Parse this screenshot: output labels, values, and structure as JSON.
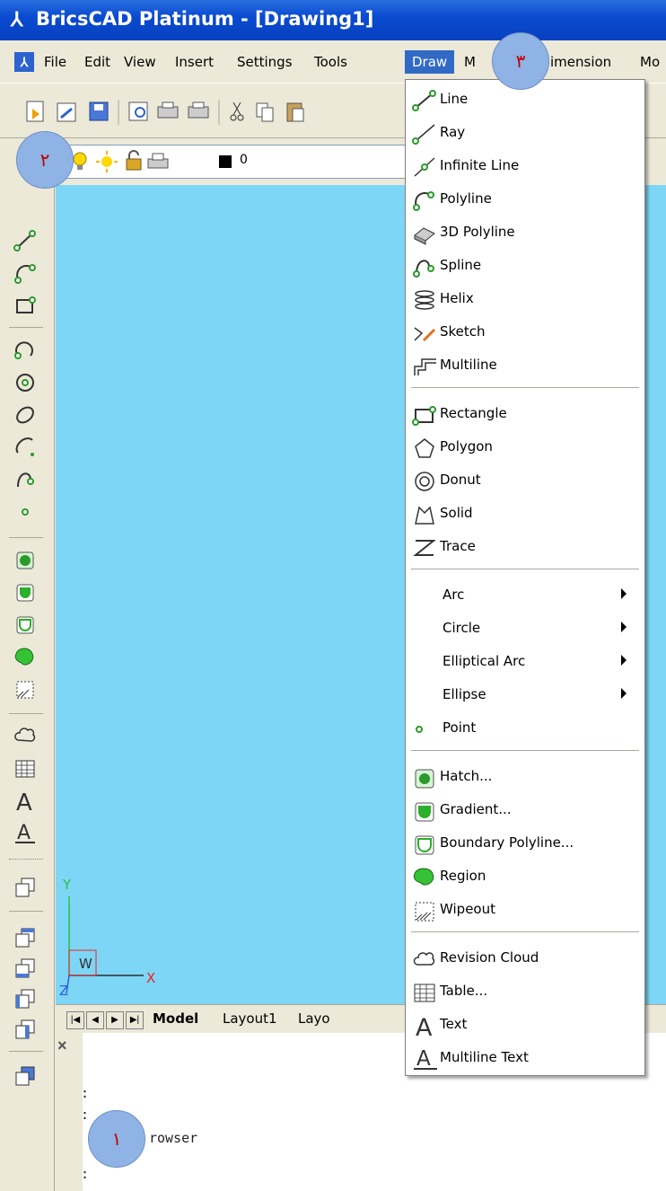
{
  "window": {
    "title": "BricsCAD Platinum - [Drawing1]"
  },
  "menubar": {
    "items": [
      "File",
      "Edit",
      "View",
      "Insert",
      "Settings",
      "Tools",
      "Draw",
      "M",
      "imension",
      "Mo"
    ],
    "active": "Draw"
  },
  "layer": {
    "name": "0"
  },
  "draw_menu": {
    "items": [
      {
        "label": "Line",
        "icon": "line-icon"
      },
      {
        "label": "Ray",
        "icon": "ray-icon"
      },
      {
        "label": "Infinite Line",
        "icon": "infinite-line-icon"
      },
      {
        "label": "Polyline",
        "icon": "polyline-icon"
      },
      {
        "label": "3D Polyline",
        "icon": "3d-polyline-icon"
      },
      {
        "label": "Spline",
        "icon": "spline-icon"
      },
      {
        "label": "Helix",
        "icon": "helix-icon"
      },
      {
        "label": "Sketch",
        "icon": "sketch-icon"
      },
      {
        "label": "Multiline",
        "icon": "multiline-icon"
      },
      {
        "label": "Rectangle",
        "icon": "rectangle-icon"
      },
      {
        "label": "Polygon",
        "icon": "polygon-icon"
      },
      {
        "label": "Donut",
        "icon": "donut-icon"
      },
      {
        "label": "Solid",
        "icon": "solid-icon"
      },
      {
        "label": "Trace",
        "icon": "trace-icon"
      },
      {
        "label": "Arc",
        "icon": ""
      },
      {
        "label": "Circle",
        "icon": ""
      },
      {
        "label": "Elliptical Arc",
        "icon": ""
      },
      {
        "label": "Ellipse",
        "icon": ""
      },
      {
        "label": "Point",
        "icon": "point-icon"
      },
      {
        "label": "Hatch...",
        "icon": "hatch-icon"
      },
      {
        "label": "Gradient...",
        "icon": "gradient-icon"
      },
      {
        "label": "Boundary Polyline...",
        "icon": "boundary-polyline-icon"
      },
      {
        "label": "Region",
        "icon": "region-icon"
      },
      {
        "label": "Wipeout",
        "icon": "wipeout-icon"
      },
      {
        "label": "Revision Cloud",
        "icon": "revision-cloud-icon"
      },
      {
        "label": "Table...",
        "icon": "table-icon"
      },
      {
        "label": "Text",
        "icon": "text-icon"
      },
      {
        "label": "Multiline Text",
        "icon": "multiline-text-icon"
      }
    ]
  },
  "tabs": {
    "model": "Model",
    "layout1": "Layout1",
    "layout2": "Layo"
  },
  "ucs": {
    "x": "X",
    "y": "Y",
    "z": "Z",
    "w": "W"
  },
  "command": {
    "line1": ":",
    "line2": ":",
    "line3": "rowser",
    "prompt": ":"
  },
  "badges": {
    "b1": "١",
    "b2": "٢",
    "b3": "٣"
  },
  "colors": {
    "canvas": "#7dd6f6",
    "titlebar": "#0a4bd0",
    "menu_highlight": "#316ac5",
    "badge": "#8fb3e5",
    "badge_text": "#c00000"
  }
}
